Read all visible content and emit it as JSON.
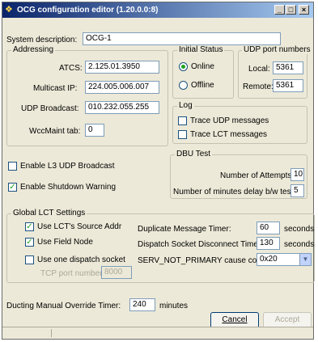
{
  "window": {
    "title": "OCG configuration editor (1.20.0.0:8)",
    "minimize_glyph": "_",
    "maximize_glyph": "□",
    "close_glyph": "×"
  },
  "system_description": {
    "label": "System description:",
    "value": "OCG-1"
  },
  "addressing": {
    "legend": "Addressing",
    "atcs_label": "ATCS:",
    "atcs_value": "2.125.01.3950",
    "multicast_label": "Multicast IP:",
    "multicast_value": "224.005.006.007",
    "udp_broadcast_label": "UDP Broadcast:",
    "udp_broadcast_value": "010.232.055.255",
    "wccmaint_label": "WccMaint tab:",
    "wccmaint_value": "0"
  },
  "initial_status": {
    "legend": "Initial Status",
    "online_label": "Online",
    "offline_label": "Offline",
    "selected": "Online"
  },
  "udp_ports": {
    "legend": "UDP port numbers",
    "local_label": "Local:",
    "local_value": "5361",
    "remote_label": "Remote:",
    "remote_value": "5361"
  },
  "log": {
    "legend": "Log",
    "trace_udp_label": "Trace UDP messages",
    "trace_udp_checked": false,
    "trace_lct_label": "Trace LCT messages",
    "trace_lct_checked": false
  },
  "enable_l3": {
    "label": "Enable L3 UDP Broadcast",
    "checked": false
  },
  "enable_shutdown": {
    "label": "Enable Shutdown Warning",
    "checked": true
  },
  "dbu_test": {
    "legend": "DBU Test",
    "attempts_label": "Number of Attempts:",
    "attempts_value": "10",
    "delay_label": "Number of minutes delay b/w tests:",
    "delay_value": "5"
  },
  "global_lct": {
    "legend": "Global LCT Settings",
    "use_source_addr_label": "Use LCT's Source Addr",
    "use_source_addr_checked": true,
    "use_field_node_label": "Use Field Node",
    "use_field_node_checked": true,
    "use_one_socket_label": "Use one dispatch socket",
    "use_one_socket_checked": false,
    "tcp_port_label": "TCP port number:",
    "tcp_port_value": "8000",
    "dup_timer_label": "Duplicate Message Timer:",
    "dup_timer_value": "60",
    "dup_timer_unit": "seconds",
    "disconnect_label": "Dispatch Socket Disconnect Time:",
    "disconnect_value": "130",
    "disconnect_unit": "seconds",
    "serv_label": "SERV_NOT_PRIMARY cause code:",
    "serv_value": "0x20"
  },
  "ducting": {
    "label": "Ducting Manual Override Timer:",
    "value": "240",
    "unit": "minutes"
  },
  "buttons": {
    "cancel": "Cancel",
    "accept": "Accept"
  },
  "colors": {
    "title_start": "#0a246a",
    "title_end": "#a6caf0",
    "dialog_bg": "#ece9d8",
    "check": "#21a121"
  },
  "icons": {
    "title": "app-icon",
    "dropdown": "chevron-down-icon"
  }
}
